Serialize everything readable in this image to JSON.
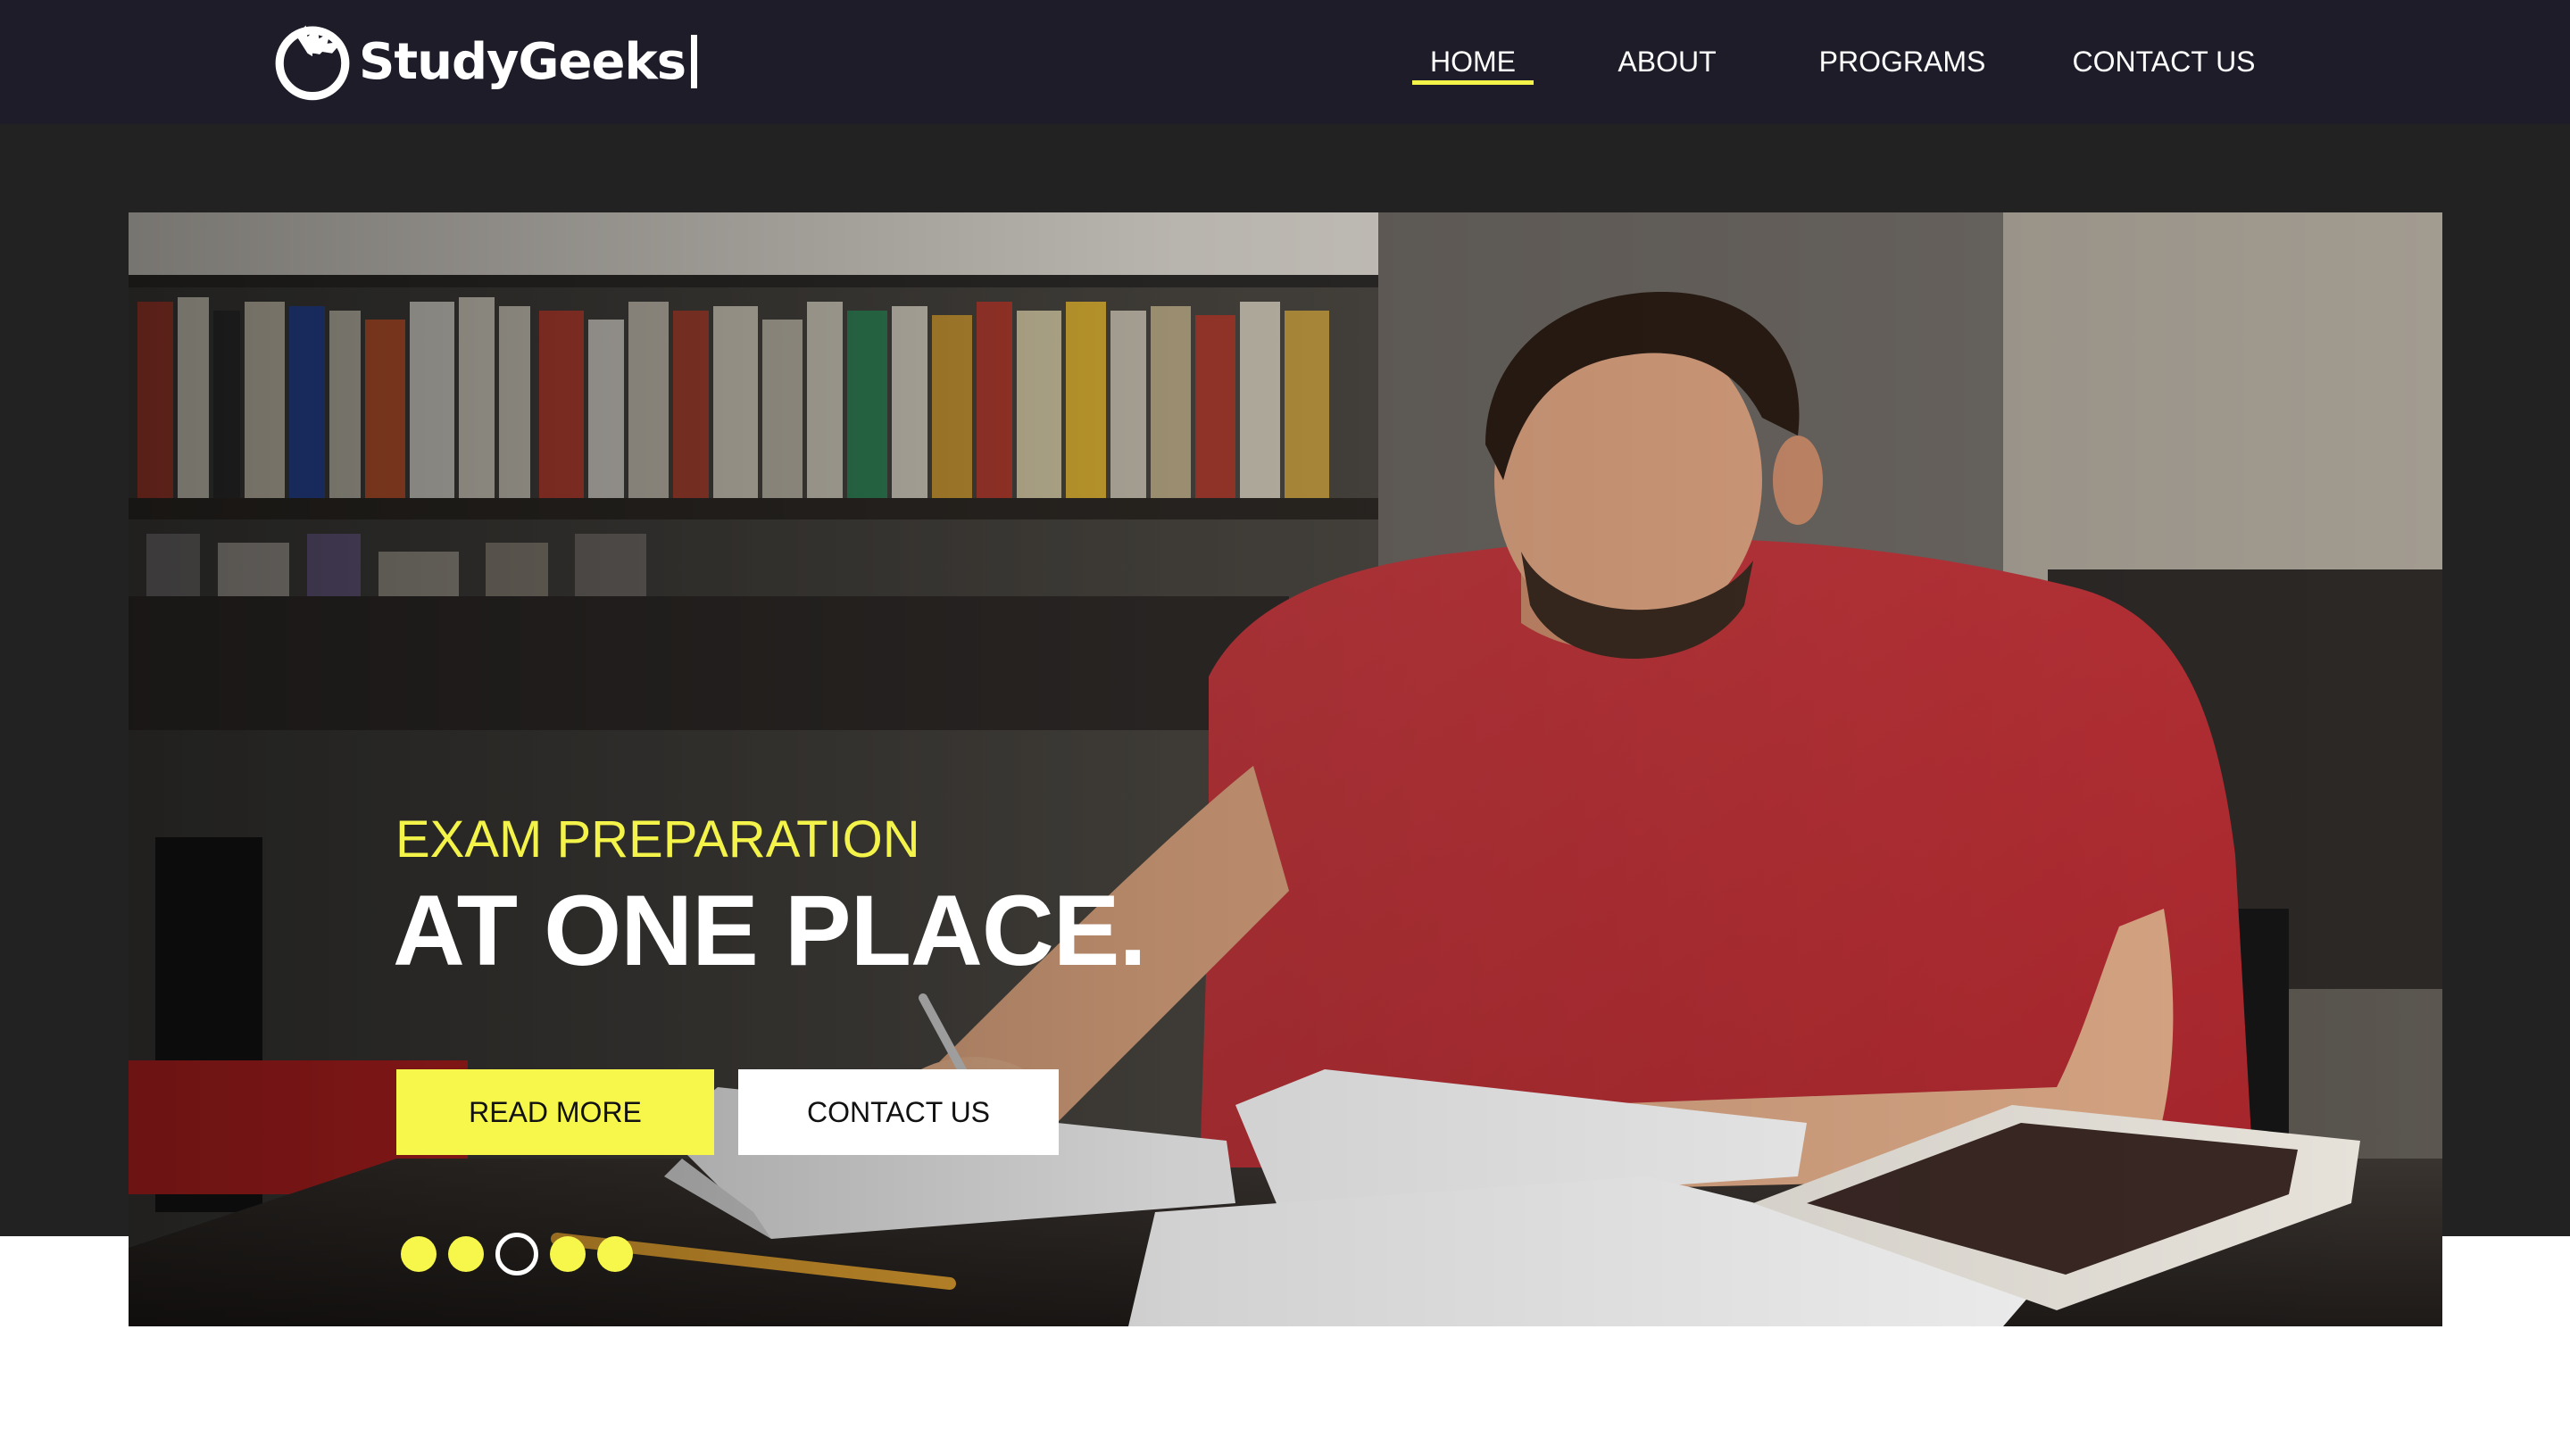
{
  "header": {
    "brand": "StudyGeeks",
    "nav": {
      "home": "HOME",
      "about": "ABOUT",
      "programs": "PROGRAMS",
      "contact": "CONTACT US"
    },
    "active_nav": "HOME"
  },
  "hero": {
    "subtitle": "EXAM PREPARATION",
    "title": "AT ONE PLACE.",
    "buttons": {
      "read_more": "READ MORE",
      "contact": "CONTACT US"
    },
    "carousel": {
      "slide_count": 5,
      "active_index": 2
    },
    "image": "student-studying-in-library"
  },
  "colors": {
    "navbar_bg": "#1d1c28",
    "band_bg": "#222222",
    "accent_yellow": "#f7f74b",
    "text_white": "#ffffff"
  },
  "icons": {
    "brand_logo": "dragon-logo-icon"
  }
}
